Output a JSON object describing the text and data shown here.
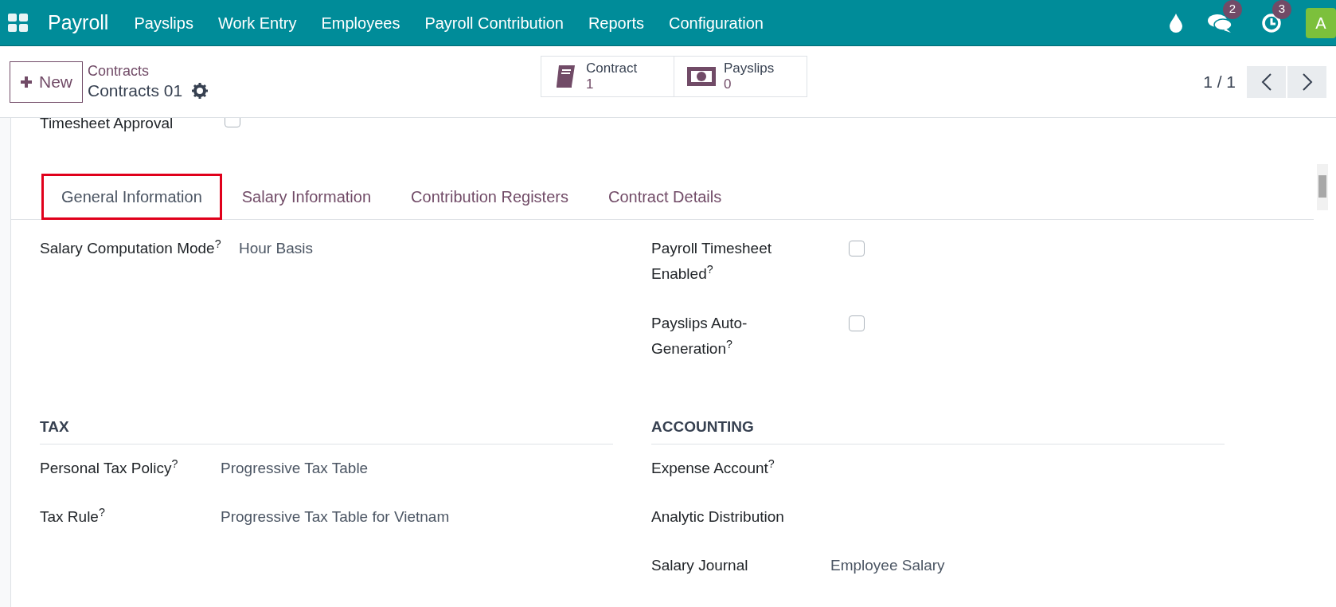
{
  "navbar": {
    "app": "Payroll",
    "menu": [
      "Payslips",
      "Work Entry",
      "Employees",
      "Payroll Contribution",
      "Reports",
      "Configuration"
    ],
    "messages_badge": "2",
    "activities_badge": "3",
    "avatar": "A"
  },
  "control_panel": {
    "new_button": "New",
    "breadcrumb": "Contracts",
    "record": "Contracts 01",
    "smart_buttons": [
      {
        "kind": "book",
        "label": "Contract",
        "count": "1"
      },
      {
        "kind": "money",
        "label": "Payslips",
        "count": "0"
      }
    ],
    "pager": "1 / 1"
  },
  "partial_field": {
    "label": "Timesheet Approval",
    "checked": false
  },
  "tabs": [
    {
      "label": "General Information",
      "selected": true,
      "highlighted": true
    },
    {
      "label": "Salary Information",
      "selected": false,
      "highlighted": false
    },
    {
      "label": "Contribution Registers",
      "selected": false,
      "highlighted": false
    },
    {
      "label": "Contract Details",
      "selected": false,
      "highlighted": false
    }
  ],
  "left_fields": [
    {
      "label": "Salary Computation Mode$^{?}$",
      "value": "Hour Basis"
    }
  ],
  "right_fields": [
    {
      "label": "Payroll Timesheet Enabled$^{?}$",
      "checked": false
    },
    {
      "label": "Payslips Auto-Generation$^{?}$",
      "checked": false
    }
  ],
  "tax": {
    "title": "TAX",
    "fields": [
      {
        "label": "Personal Tax Policy$^{?}$",
        "value": "Progressive Tax Table"
      },
      {
        "label": "Tax Rule$^{?}$",
        "value": "Progressive Tax Table for Vietnam"
      }
    ]
  },
  "accounting": {
    "title": "ACCOUNTING",
    "fields": [
      {
        "label": "Expense Account$^{?}$"
      },
      {
        "label": "Analytic Distribution"
      },
      {
        "label": "Salary Journal",
        "value": "Employee Salary"
      }
    ]
  }
}
